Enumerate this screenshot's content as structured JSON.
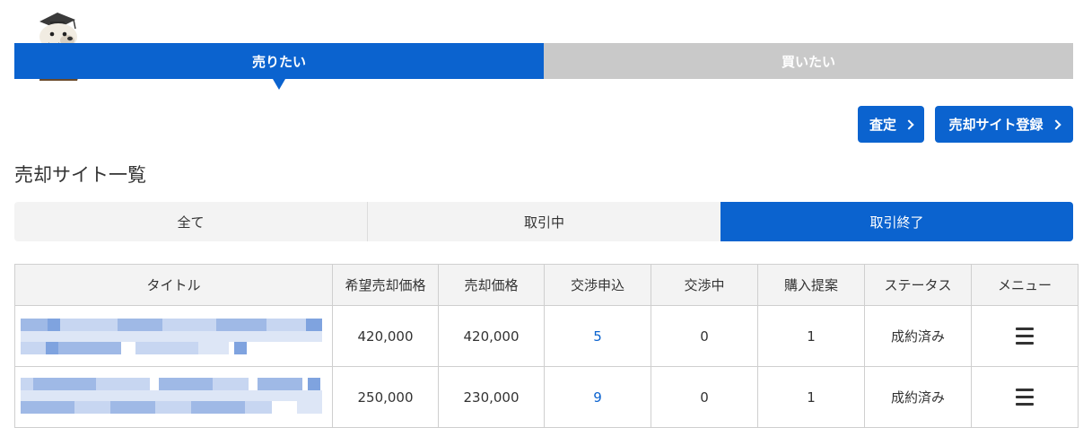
{
  "top_tabs": {
    "sell_label": "売りたい",
    "buy_label": "買いたい",
    "active": "sell"
  },
  "actions": {
    "assess_label": "査定",
    "register_label": "売却サイト登録"
  },
  "page_title": "売却サイト一覧",
  "filter_tabs": {
    "all_label": "全て",
    "in_progress_label": "取引中",
    "completed_label": "取引終了",
    "active": "completed"
  },
  "table": {
    "headers": {
      "title": "タイトル",
      "desired_price": "希望売却価格",
      "sale_price": "売却価格",
      "negotiation_requests": "交渉申込",
      "negotiating": "交渉中",
      "purchase_offers": "購入提案",
      "status": "ステータス",
      "menu": "メニュー"
    },
    "rows": [
      {
        "desired_price": "420,000",
        "sale_price": "420,000",
        "negotiation_requests": "5",
        "negotiating": "0",
        "purchase_offers": "1",
        "status": "成約済み"
      },
      {
        "desired_price": "250,000",
        "sale_price": "230,000",
        "negotiation_requests": "9",
        "negotiating": "0",
        "purchase_offers": "1",
        "status": "成約済み"
      }
    ]
  },
  "colors": {
    "primary": "#0b63cf",
    "inactive_tab": "#c9c9c9",
    "table_header_bg": "#f3f3f3"
  },
  "icons": {
    "mascot": "sea-otter-graduate-mascot",
    "chevron": "chevron-right-icon",
    "menu": "hamburger-menu-icon"
  }
}
